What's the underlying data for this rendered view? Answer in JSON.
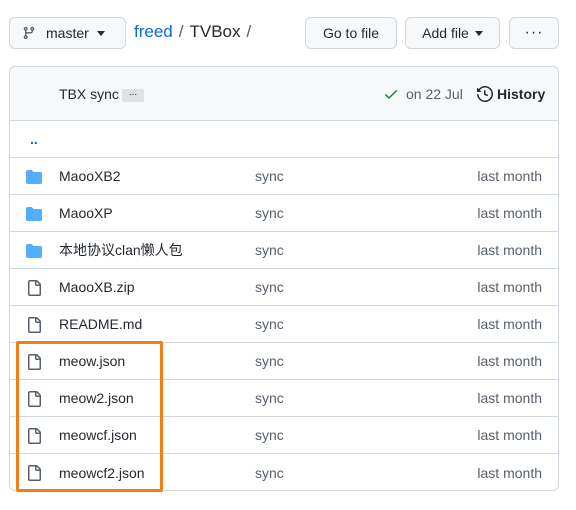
{
  "branch": {
    "name": "master",
    "icon": "git-branch-icon"
  },
  "breadcrumb": {
    "owner": "freed",
    "sep1": "/",
    "dir": "TVBox",
    "sep2": "/"
  },
  "actions": {
    "go_to_file": "Go to file",
    "add_file": "Add file",
    "more": "···"
  },
  "commit": {
    "author": "TBX",
    "message": "sync",
    "ellipsis": "...",
    "date": "on 22 Jul",
    "history": "History",
    "colors": {
      "check": "#1a7f37"
    }
  },
  "parent_link": "..",
  "files": [
    {
      "type": "folder",
      "icon": "folder-icon",
      "name": "MaooXB2",
      "message": "sync",
      "age": "last month"
    },
    {
      "type": "folder",
      "icon": "folder-icon",
      "name": "MaooXP",
      "message": "sync",
      "age": "last month"
    },
    {
      "type": "folder",
      "icon": "folder-icon",
      "name": "本地协议clan懒人包",
      "message": "sync",
      "age": "last month"
    },
    {
      "type": "file",
      "icon": "file-icon",
      "name": "MaooXB.zip",
      "message": "sync",
      "age": "last month"
    },
    {
      "type": "file",
      "icon": "file-icon",
      "name": "README.md",
      "message": "sync",
      "age": "last month"
    },
    {
      "type": "file",
      "icon": "file-icon",
      "name": "meow.json",
      "message": "sync",
      "age": "last month"
    },
    {
      "type": "file",
      "icon": "file-icon",
      "name": "meow2.json",
      "message": "sync",
      "age": "last month"
    },
    {
      "type": "file",
      "icon": "file-icon",
      "name": "meowcf.json",
      "message": "sync",
      "age": "last month"
    },
    {
      "type": "file",
      "icon": "file-icon",
      "name": "meowcf2.json",
      "message": "sync",
      "age": "last month"
    }
  ],
  "colors": {
    "link": "#0969da",
    "folder": "#54aeff",
    "highlight": "#f07e1b"
  }
}
